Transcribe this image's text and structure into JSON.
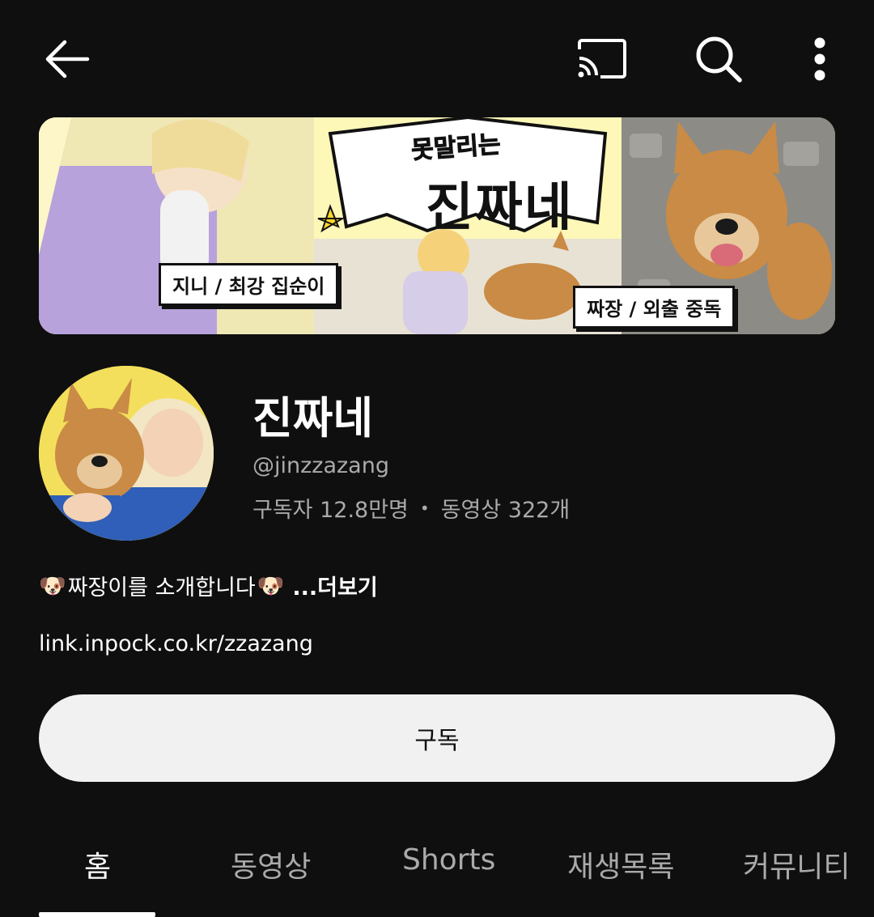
{
  "toolbar": {
    "back_icon": "arrow-left-icon",
    "cast_icon": "cast-icon",
    "search_icon": "search-icon",
    "more_icon": "more-vert-icon"
  },
  "banner": {
    "title_small": "못말리는",
    "title_big": "진짜네",
    "tag_left": "지니 / 최강 집순이",
    "tag_right": "짜장 / 외출 중독"
  },
  "channel": {
    "name": "진짜네",
    "handle": "@jinzzazang",
    "subscribers": "구독자 12.8만명",
    "separator": "•",
    "videos": "동영상 322개",
    "description": "짜장이를 소개합니다",
    "description_emoji": "🐶",
    "more_label": "...더보기",
    "link": "link.inpock.co.kr/zzazang"
  },
  "subscribe": {
    "label": "구독"
  },
  "tabs": [
    {
      "label": "홈",
      "active": true
    },
    {
      "label": "동영상",
      "active": false
    },
    {
      "label": "Shorts",
      "active": false
    },
    {
      "label": "재생목록",
      "active": false
    },
    {
      "label": "커뮤니티",
      "active": false
    }
  ],
  "colors": {
    "background": "#0f0f0f",
    "text_primary": "#ffffff",
    "text_secondary": "#aaaaaa",
    "subscribe_bg": "#f1f1f1",
    "banner_yellow": "#f7e36b"
  }
}
